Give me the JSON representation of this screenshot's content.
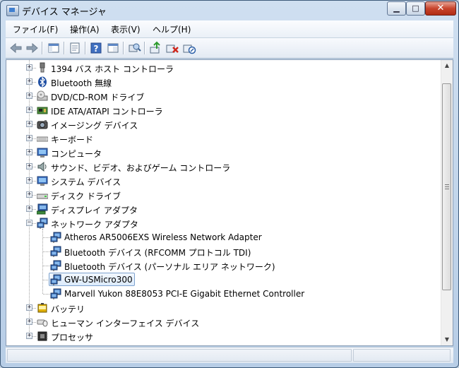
{
  "window": {
    "title": "デバイス マネージャ",
    "colors": {
      "selection_border": "#7da2ce",
      "close_button": "#c8442c",
      "frame": "#b7cde6"
    }
  },
  "menubar": [
    {
      "label": "ファイル(F)"
    },
    {
      "label": "操作(A)"
    },
    {
      "label": "表示(V)"
    },
    {
      "label": "ヘルプ(H)"
    }
  ],
  "toolbar": [
    {
      "name": "back-button",
      "icon": "back-arrow-icon"
    },
    {
      "name": "forward-button",
      "icon": "forward-arrow-icon"
    },
    {
      "name": "show-hide-tree-button",
      "icon": "console-tree-icon"
    },
    {
      "name": "properties-button",
      "icon": "properties-icon"
    },
    {
      "name": "help-button",
      "icon": "help-icon"
    },
    {
      "name": "view-button",
      "icon": "view-icon"
    },
    {
      "name": "scan-hardware-button",
      "icon": "scan-hardware-icon"
    },
    {
      "name": "update-driver-button",
      "icon": "update-driver-icon"
    },
    {
      "name": "uninstall-button",
      "icon": "uninstall-icon"
    },
    {
      "name": "disable-button",
      "icon": "disable-device-icon"
    }
  ],
  "tree": [
    {
      "label": "1394 バス ホスト コントローラ",
      "icon": "usb-plug-icon",
      "expander": "+",
      "level": 0
    },
    {
      "label": "Bluetooth 無線",
      "icon": "bluetooth-icon",
      "expander": "+",
      "level": 0
    },
    {
      "label": "DVD/CD-ROM ドライブ",
      "icon": "dvd-drive-icon",
      "expander": "+",
      "level": 0
    },
    {
      "label": "IDE ATA/ATAPI コントローラ",
      "icon": "ide-controller-icon",
      "expander": "+",
      "level": 0
    },
    {
      "label": "イメージング デバイス",
      "icon": "camera-icon",
      "expander": "+",
      "level": 0
    },
    {
      "label": "キーボード",
      "icon": "keyboard-icon",
      "expander": "+",
      "level": 0
    },
    {
      "label": "コンピュータ",
      "icon": "computer-icon",
      "expander": "+",
      "level": 0
    },
    {
      "label": "サウンド、ビデオ、およびゲーム コントローラ",
      "icon": "speaker-icon",
      "expander": "+",
      "level": 0
    },
    {
      "label": "システム デバイス",
      "icon": "system-device-icon",
      "expander": "+",
      "level": 0
    },
    {
      "label": "ディスク ドライブ",
      "icon": "disk-drive-icon",
      "expander": "+",
      "level": 0
    },
    {
      "label": "ディスプレイ アダプタ",
      "icon": "display-adapter-icon",
      "expander": "+",
      "level": 0
    },
    {
      "label": "ネットワーク アダプタ",
      "icon": "network-adapter-icon",
      "expander": "−",
      "level": 0
    },
    {
      "label": "Atheros AR5006EXS Wireless Network Adapter",
      "icon": "network-adapter-icon",
      "expander": "",
      "level": 1
    },
    {
      "label": "Bluetooth デバイス (RFCOMM プロトコル TDI)",
      "icon": "network-adapter-icon",
      "expander": "",
      "level": 1
    },
    {
      "label": "Bluetooth デバイス (パーソナル エリア ネットワーク)",
      "icon": "network-adapter-icon",
      "expander": "",
      "level": 1
    },
    {
      "label": "GW-USMicro300",
      "icon": "network-adapter-icon",
      "expander": "",
      "level": 1,
      "selected": true
    },
    {
      "label": "Marvell Yukon 88E8053 PCI-E Gigabit Ethernet Controller",
      "icon": "network-adapter-icon",
      "expander": "",
      "level": 1
    },
    {
      "label": "バッテリ",
      "icon": "battery-icon",
      "expander": "+",
      "level": 0
    },
    {
      "label": "ヒューマン インターフェイス デバイス",
      "icon": "hid-icon",
      "expander": "+",
      "level": 0
    },
    {
      "label": "プロセッサ",
      "icon": "processor-icon",
      "expander": "+",
      "level": 0
    }
  ]
}
